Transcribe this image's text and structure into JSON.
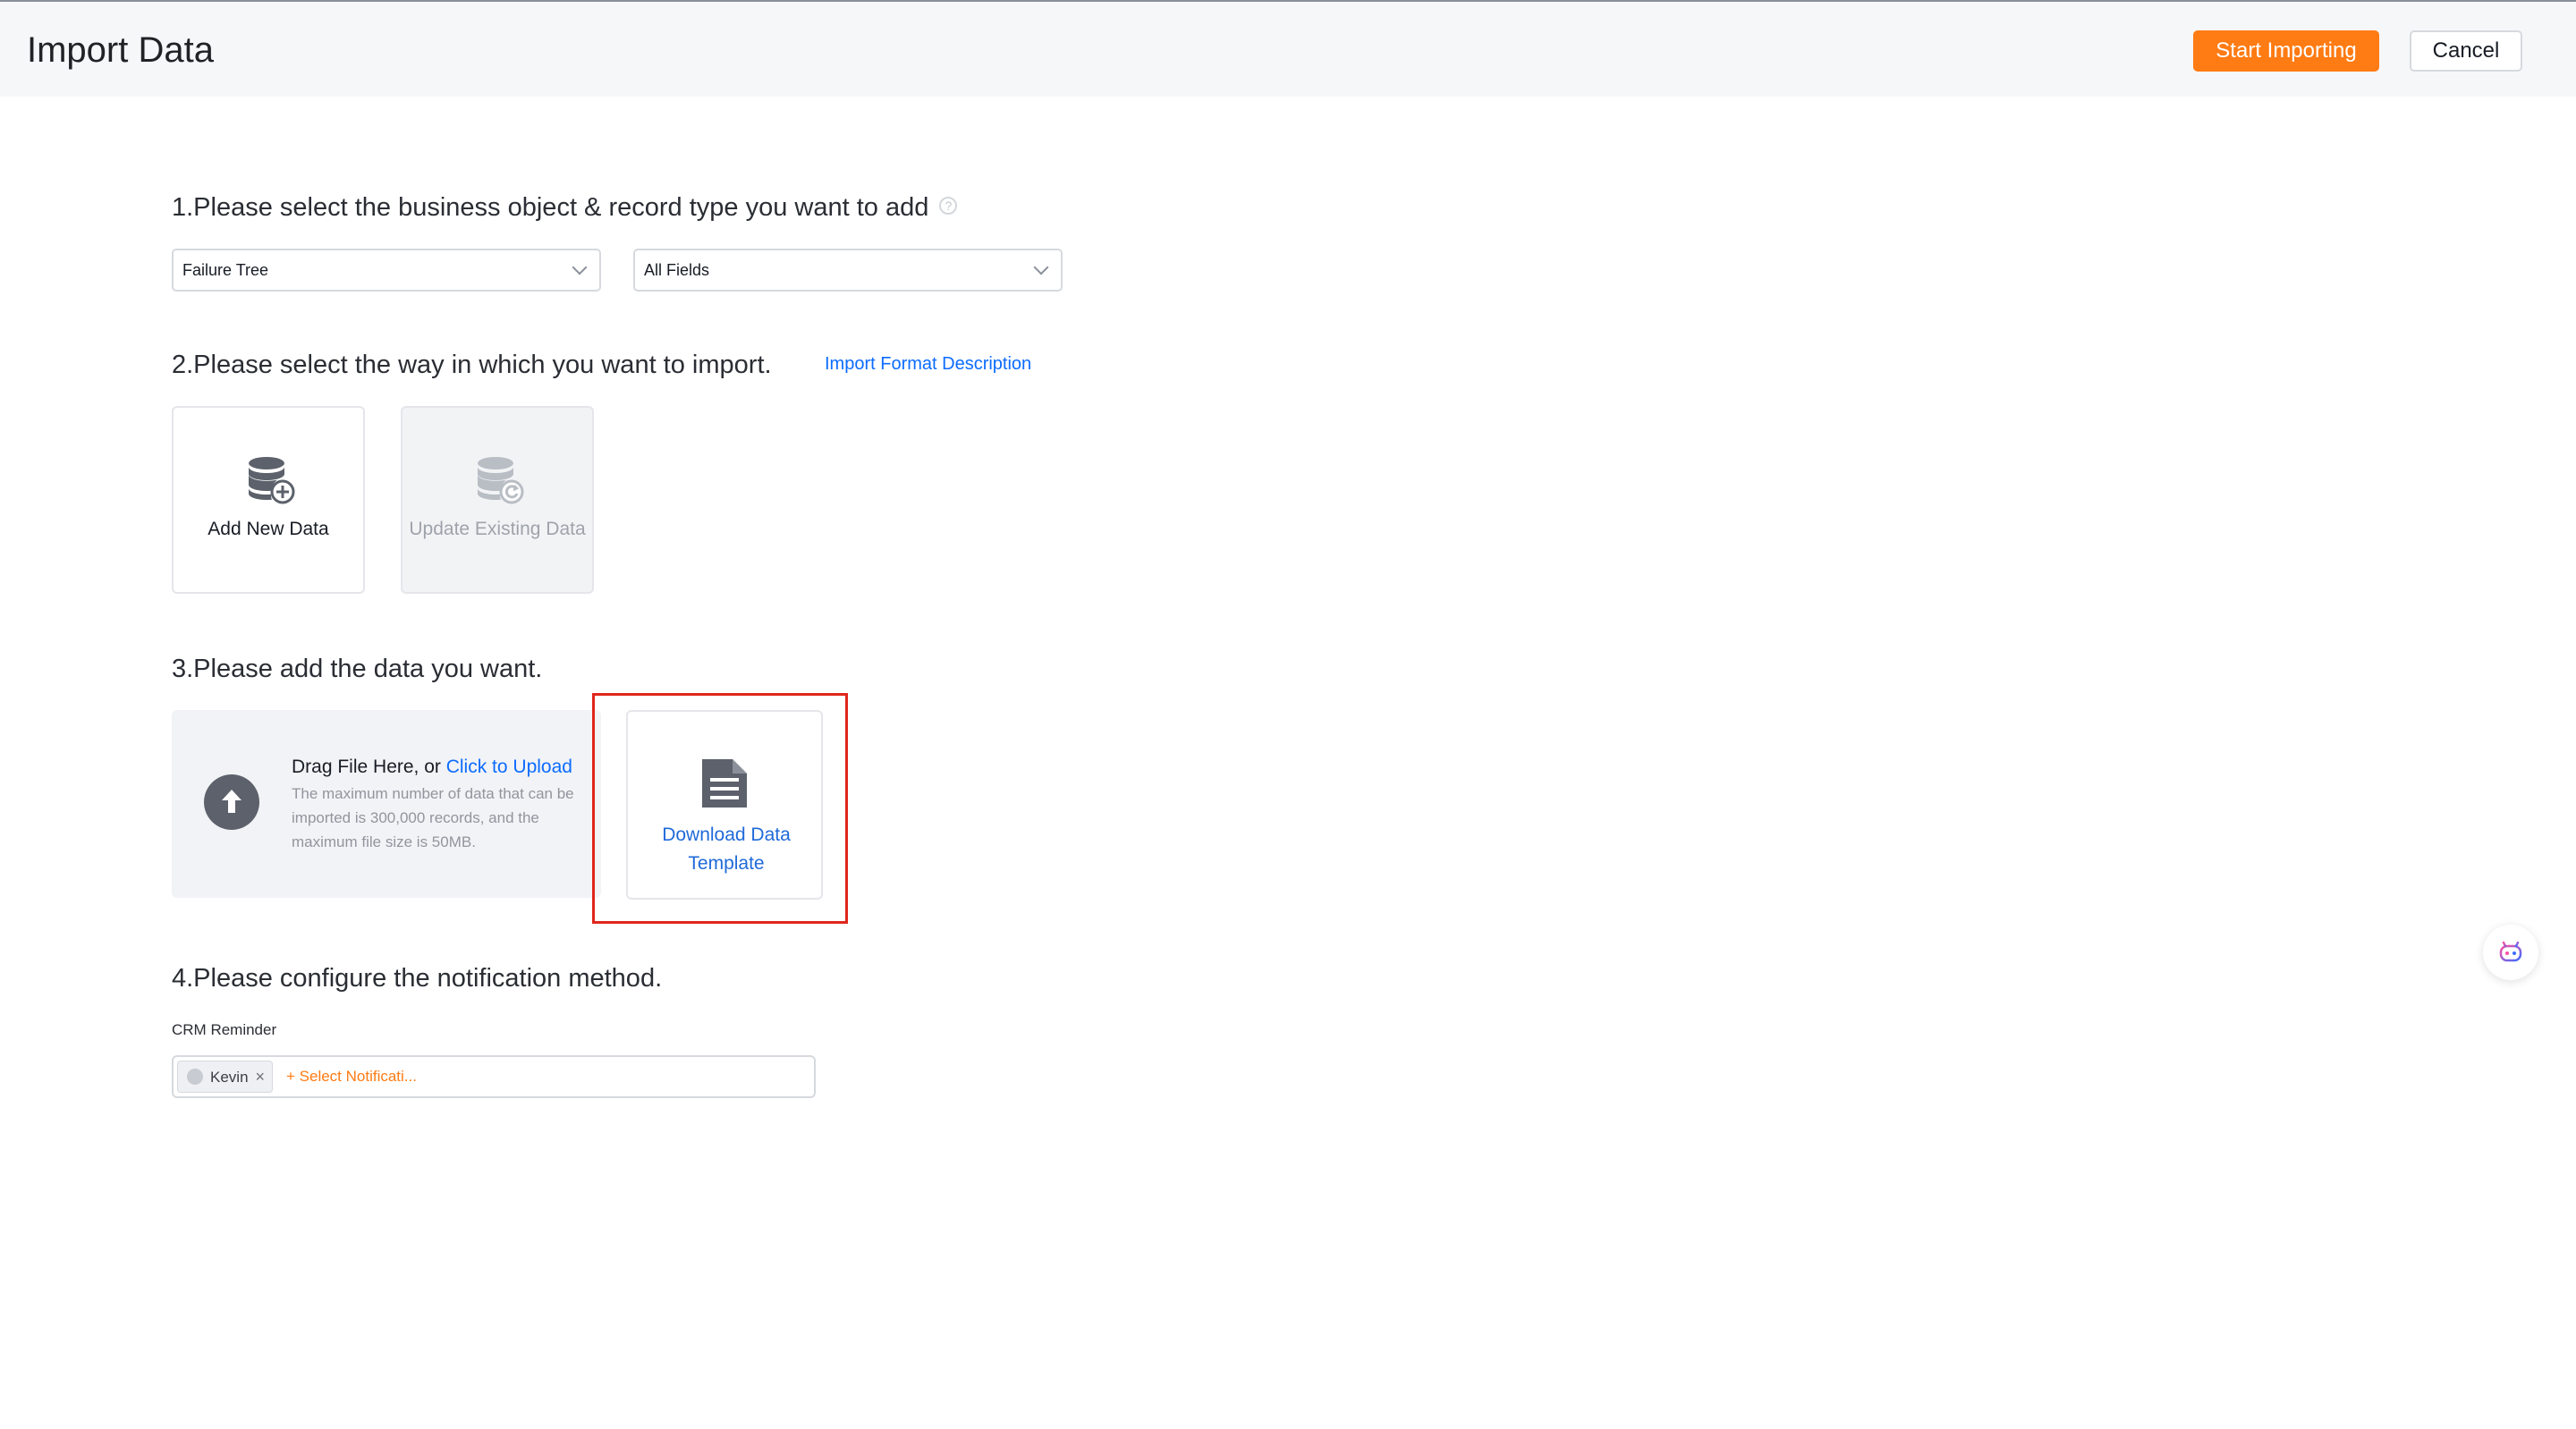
{
  "header": {
    "title": "Import Data",
    "start_label": "Start Importing",
    "cancel_label": "Cancel"
  },
  "step1": {
    "title": "1.Please select the business object & record type you want to add",
    "help_icon": "question-circle-icon",
    "object_select": "Failure Tree",
    "record_type_select": "All Fields"
  },
  "step2": {
    "title": "2.Please select the way in which you want to import.",
    "format_link": "Import Format Description",
    "methods": [
      {
        "label": "Add New Data",
        "icon": "database-add-icon",
        "enabled": true
      },
      {
        "label": "Update Existing Data",
        "icon": "database-refresh-icon",
        "enabled": false
      }
    ]
  },
  "step3": {
    "title": "3.Please add the data you want.",
    "upload_text": "Drag File Here, or ",
    "upload_link": "Click to Upload",
    "upload_desc": "The maximum number of data that can be imported is 300,000 records, and the maximum file size is 50MB.",
    "template_label": "Download Data Template",
    "upload_icon": "upload-arrow-icon",
    "template_icon": "document-icon"
  },
  "step4": {
    "title": "4.Please configure the notification method.",
    "field_label": "CRM Reminder",
    "recipients": [
      {
        "name": "Kevin"
      }
    ],
    "add_label": "+ Select Notificati..."
  },
  "colors": {
    "primary": "#ff7b13",
    "link": "#0c6cff",
    "highlight": "#e0261c"
  },
  "assistant_icon": "robot-assistant-icon"
}
